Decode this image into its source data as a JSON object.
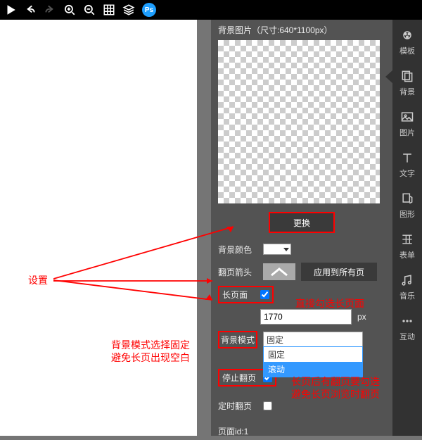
{
  "toolbar": {
    "ps": "Ps"
  },
  "rightbar": {
    "template": "模板",
    "background": "背景",
    "image": "图片",
    "text": "文字",
    "shape": "图形",
    "form": "表单",
    "music": "音乐",
    "interact": "互动"
  },
  "panel": {
    "title": "背景图片（尺寸:640*1100px）",
    "change_btn": "更换",
    "bg_color_label": "背景颜色",
    "flip_arrow_label": "翻页箭头",
    "apply_all_btn": "应用到所有页",
    "long_page_label": "长页面",
    "long_page_checked": true,
    "height_value": "1770",
    "height_unit": "px",
    "bg_mode_label": "背景模式",
    "bg_mode_value": "固定",
    "dropdown_opt1": "固定",
    "dropdown_opt2": "滚动",
    "stop_flip_label": "停止翻页",
    "stop_flip_checked": true,
    "timed_flip_label": "定时翻页",
    "timed_flip_checked": false,
    "page_id_label": "页面id:1"
  },
  "annotations": {
    "settings": "设置",
    "long_page_note": "直接勾选长页面",
    "bg_mode_note1": "背景模式选择固定",
    "bg_mode_note2": "避免长页出现空白",
    "stop_flip_note1": "长页后有翻页要勾选",
    "stop_flip_note2": "避免长页浏览时翻页"
  }
}
